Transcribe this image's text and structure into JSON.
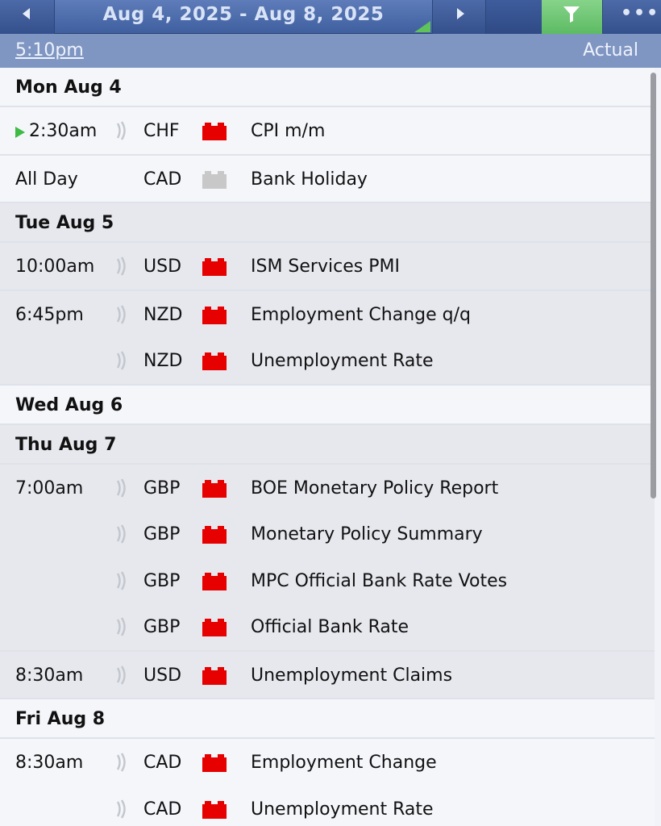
{
  "nav": {
    "date_range": "Aug 4, 2025 - Aug 8, 2025"
  },
  "header": {
    "time": "5:10pm",
    "column_label": "Actual"
  },
  "days": [
    {
      "label": "Mon Aug 4",
      "bg": "white",
      "events": [
        {
          "time": "2:30am",
          "currency": "CHF",
          "impact": "high",
          "title": "CPI m/m",
          "up_next": true
        }
      ]
    },
    {
      "label": null,
      "bg": "white",
      "events": [
        {
          "time": "All Day",
          "currency": "CAD",
          "impact": "holiday",
          "title": "Bank Holiday",
          "sound": false
        }
      ]
    },
    {
      "label": "Tue Aug 5",
      "bg": "grey",
      "events": [
        {
          "time": "10:00am",
          "currency": "USD",
          "impact": "high",
          "title": "ISM Services PMI"
        }
      ]
    },
    {
      "label": null,
      "bg": "grey",
      "events": [
        {
          "time": "6:45pm",
          "currency": "NZD",
          "impact": "high",
          "title": "Employment Change q/q"
        },
        {
          "time": "",
          "currency": "NZD",
          "impact": "high",
          "title": "Unemployment Rate"
        }
      ]
    },
    {
      "label": "Wed Aug 6",
      "bg": "white",
      "events": []
    },
    {
      "label": "Thu Aug 7",
      "bg": "grey",
      "events": [
        {
          "time": "7:00am",
          "currency": "GBP",
          "impact": "high",
          "title": "BOE Monetary Policy Report"
        },
        {
          "time": "",
          "currency": "GBP",
          "impact": "high",
          "title": "Monetary Policy Summary"
        },
        {
          "time": "",
          "currency": "GBP",
          "impact": "high",
          "title": "MPC Official Bank Rate Votes"
        },
        {
          "time": "",
          "currency": "GBP",
          "impact": "high",
          "title": "Official Bank Rate"
        }
      ]
    },
    {
      "label": null,
      "bg": "grey",
      "events": [
        {
          "time": "8:30am",
          "currency": "USD",
          "impact": "high",
          "title": "Unemployment Claims"
        }
      ]
    },
    {
      "label": "Fri Aug 8",
      "bg": "white",
      "events": [
        {
          "time": "8:30am",
          "currency": "CAD",
          "impact": "high",
          "title": "Employment Change"
        },
        {
          "time": "",
          "currency": "CAD",
          "impact": "high",
          "title": "Unemployment Rate"
        }
      ]
    }
  ],
  "colors": {
    "impact_high": "#e60000",
    "impact_holiday": "#c8c8c8",
    "filter_active": "#6cc471"
  },
  "icons": {
    "prev": "triangle-left-icon",
    "next": "triangle-right-icon",
    "filter": "funnel-icon",
    "more": "ellipsis-icon",
    "sound": "sound-wave-icon",
    "impact": "folder-impact-icon",
    "up_next": "up-next-arrow-icon"
  }
}
